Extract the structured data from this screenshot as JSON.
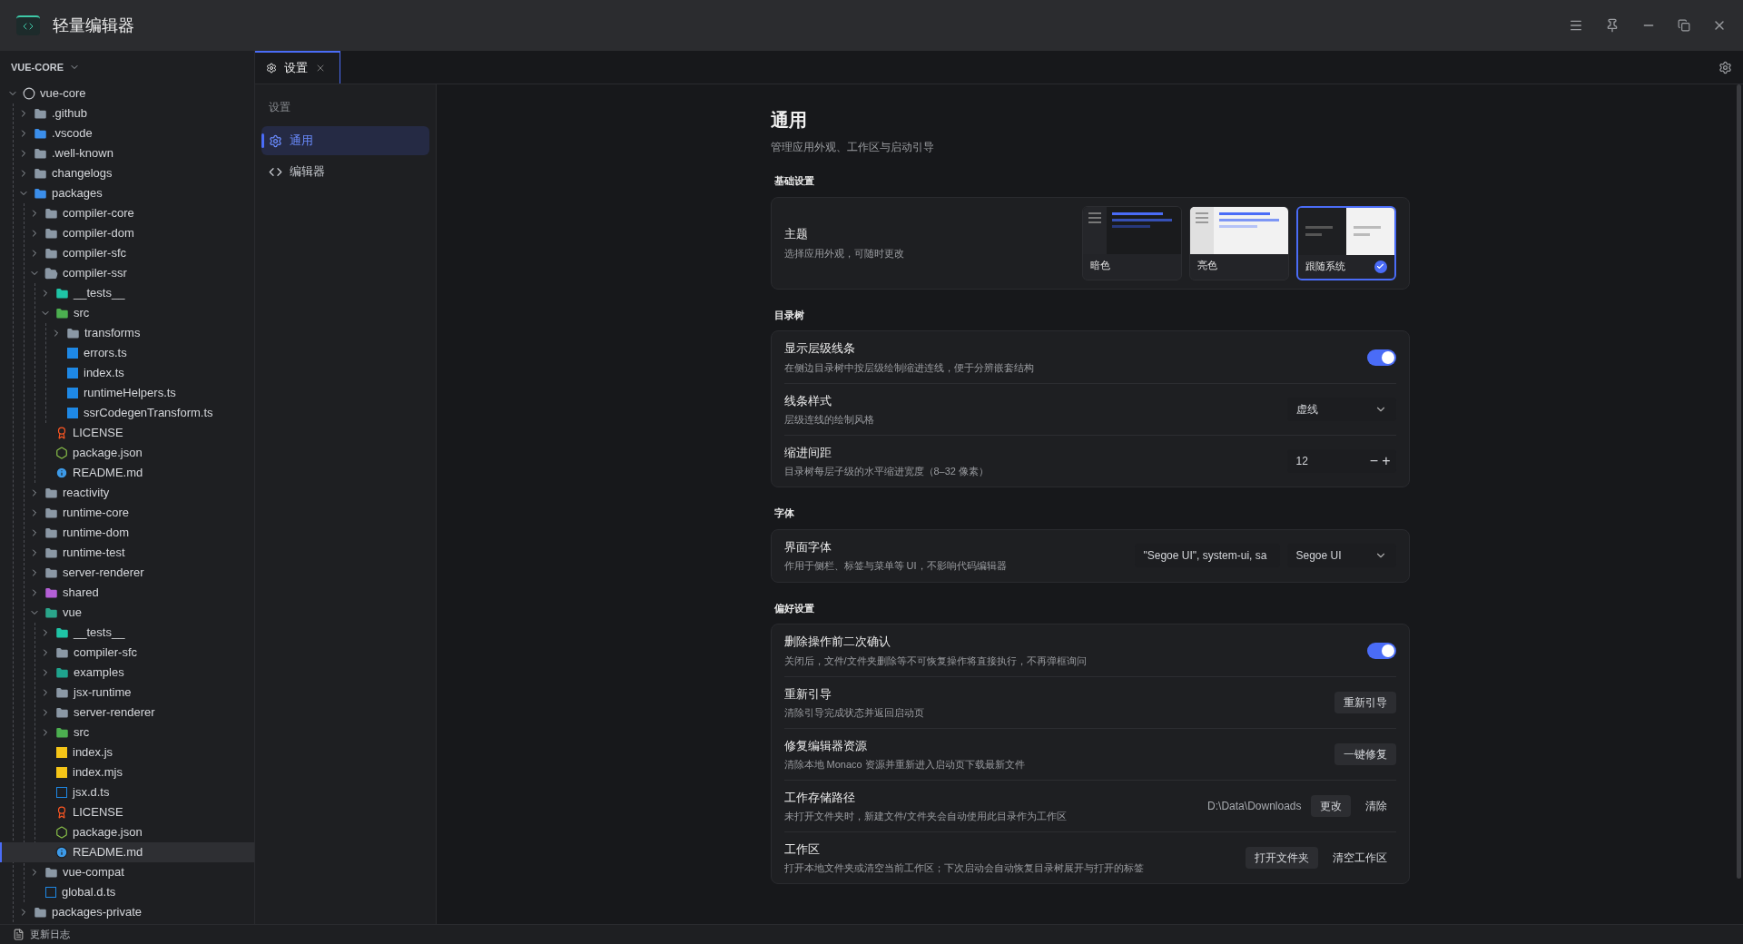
{
  "window": {
    "title": "轻量编辑器"
  },
  "explorer": {
    "title": "VUE-CORE",
    "tree": [
      {
        "name": "vue-core",
        "kind": "root",
        "expanded": true,
        "selected": false,
        "children": [
          {
            "name": ".github",
            "kind": "github",
            "expanded": false,
            "selected": false
          },
          {
            "name": ".vscode",
            "kind": "vscode",
            "expanded": false,
            "selected": false
          },
          {
            "name": ".well-known",
            "kind": "folder",
            "expanded": false,
            "selected": false
          },
          {
            "name": "changelogs",
            "kind": "folder",
            "expanded": false,
            "selected": false
          },
          {
            "name": "packages",
            "kind": "packages",
            "expanded": true,
            "selected": false,
            "children": [
              {
                "name": "compiler-core",
                "kind": "folder",
                "expanded": false,
                "selected": false
              },
              {
                "name": "compiler-dom",
                "kind": "folder",
                "expanded": false,
                "selected": false
              },
              {
                "name": "compiler-sfc",
                "kind": "folder",
                "expanded": false,
                "selected": false
              },
              {
                "name": "compiler-ssr",
                "kind": "open",
                "expanded": true,
                "selected": false,
                "children": [
                  {
                    "name": "__tests__",
                    "kind": "tests",
                    "expanded": false,
                    "selected": false
                  },
                  {
                    "name": "src",
                    "kind": "src",
                    "expanded": true,
                    "selected": false,
                    "children": [
                      {
                        "name": "transforms",
                        "kind": "folder",
                        "expanded": false,
                        "selected": false
                      },
                      {
                        "name": "errors.ts",
                        "kind": "ts",
                        "selected": false
                      },
                      {
                        "name": "index.ts",
                        "kind": "ts",
                        "selected": false
                      },
                      {
                        "name": "runtimeHelpers.ts",
                        "kind": "ts",
                        "selected": false
                      },
                      {
                        "name": "ssrCodegenTransform.ts",
                        "kind": "ts",
                        "selected": false
                      }
                    ]
                  },
                  {
                    "name": "LICENSE",
                    "kind": "license",
                    "selected": false
                  },
                  {
                    "name": "package.json",
                    "kind": "node",
                    "selected": false
                  },
                  {
                    "name": "README.md",
                    "kind": "info",
                    "selected": false
                  }
                ]
              },
              {
                "name": "reactivity",
                "kind": "folder",
                "expanded": false,
                "selected": false
              },
              {
                "name": "runtime-core",
                "kind": "folder",
                "expanded": false,
                "selected": false
              },
              {
                "name": "runtime-dom",
                "kind": "folder",
                "expanded": false,
                "selected": false
              },
              {
                "name": "runtime-test",
                "kind": "folder",
                "expanded": false,
                "selected": false
              },
              {
                "name": "server-renderer",
                "kind": "folder",
                "expanded": false,
                "selected": false
              },
              {
                "name": "shared",
                "kind": "shared",
                "expanded": false,
                "selected": false
              },
              {
                "name": "vue",
                "kind": "vue",
                "expanded": true,
                "selected": false,
                "children": [
                  {
                    "name": "__tests__",
                    "kind": "tests",
                    "expanded": false,
                    "selected": false
                  },
                  {
                    "name": "compiler-sfc",
                    "kind": "folder",
                    "expanded": false,
                    "selected": false
                  },
                  {
                    "name": "examples",
                    "kind": "examples",
                    "expanded": false,
                    "selected": false
                  },
                  {
                    "name": "jsx-runtime",
                    "kind": "folder",
                    "expanded": false,
                    "selected": false
                  },
                  {
                    "name": "server-renderer",
                    "kind": "folder",
                    "expanded": false,
                    "selected": false
                  },
                  {
                    "name": "src",
                    "kind": "src",
                    "expanded": false,
                    "selected": false
                  },
                  {
                    "name": "index.js",
                    "kind": "js",
                    "selected": false
                  },
                  {
                    "name": "index.mjs",
                    "kind": "js",
                    "selected": false
                  },
                  {
                    "name": "jsx.d.ts",
                    "kind": "dts",
                    "selected": false
                  },
                  {
                    "name": "LICENSE",
                    "kind": "license",
                    "selected": false
                  },
                  {
                    "name": "package.json",
                    "kind": "node",
                    "selected": false
                  },
                  {
                    "name": "README.md",
                    "kind": "info",
                    "selected": true
                  }
                ]
              },
              {
                "name": "vue-compat",
                "kind": "folder",
                "expanded": false,
                "selected": false
              },
              {
                "name": "global.d.ts",
                "kind": "dts",
                "selected": false
              }
            ]
          },
          {
            "name": "packages-private",
            "kind": "folder",
            "expanded": false,
            "selected": false
          }
        ]
      }
    ]
  },
  "tabs": [
    {
      "label": "设置",
      "selected": true
    }
  ],
  "settings_nav": {
    "title": "设置",
    "items": [
      {
        "label": "通用",
        "kind": "gear",
        "selected": true
      },
      {
        "label": "编辑器",
        "kind": "code",
        "selected": false
      }
    ]
  },
  "page": {
    "title": "通用",
    "subtitle": "管理应用外观、工作区与启动引导"
  },
  "sections": [
    {
      "title": "基础设置",
      "rows": [
        {
          "kind": "theme",
          "label": "主题",
          "description": "选择应用外观，可随时更改",
          "options": [
            {
              "label": "暗色",
              "kind": "dark",
              "selected": false
            },
            {
              "label": "亮色",
              "kind": "light",
              "selected": false
            },
            {
              "label": "跟随系统",
              "kind": "system",
              "selected": true
            }
          ]
        }
      ]
    },
    {
      "title": "目录树",
      "rows": [
        {
          "kind": "toggle",
          "label": "显示层级线条",
          "description": "在侧边目录树中按层级绘制缩进连线，便于分辨嵌套结构",
          "on": true
        },
        {
          "kind": "select",
          "label": "线条样式",
          "description": "层级连线的绘制风格",
          "value": "虚线"
        },
        {
          "kind": "stepper",
          "label": "缩进间距",
          "description": "目录树每层子级的水平缩进宽度（8–32 像素）",
          "value": "12",
          "minus": "−",
          "plus": "+"
        }
      ]
    },
    {
      "title": "字体",
      "rows": [
        {
          "kind": "font",
          "label": "界面字体",
          "description": "作用于侧栏、标签与菜单等 UI，不影响代码编辑器",
          "input": "\"Segoe UI\", system-ui, sa",
          "value": "Segoe UI"
        }
      ]
    },
    {
      "title": "偏好设置",
      "rows": [
        {
          "kind": "toggle",
          "label": "删除操作前二次确认",
          "description": "关闭后，文件/文件夹删除等不可恢复操作将直接执行，不再弹框询问",
          "on": true
        },
        {
          "kind": "buttons",
          "label": "重新引导",
          "description": "清除引导完成状态并返回启动页",
          "buttons": [
            {
              "label": "重新引导",
              "kind": "filled"
            }
          ]
        },
        {
          "kind": "buttons",
          "label": "修复编辑器资源",
          "description": "清除本地 Monaco 资源并重新进入启动页下载最新文件",
          "buttons": [
            {
              "label": "一键修复",
              "kind": "filled"
            }
          ]
        },
        {
          "kind": "buttons",
          "label": "工作存储路径",
          "description": "未打开文件夹时，新建文件/文件夹会自动使用此目录作为工作区",
          "path": "D:\\Data\\Downloads",
          "buttons": [
            {
              "label": "更改",
              "kind": "filled"
            },
            {
              "label": "清除",
              "kind": "plain"
            }
          ]
        },
        {
          "kind": "buttons",
          "label": "工作区",
          "description": "打开本地文件夹或清空当前工作区；下次启动会自动恢复目录树展开与打开的标签",
          "buttons": [
            {
              "label": "打开文件夹",
              "kind": "filled"
            },
            {
              "label": "清空工作区",
              "kind": "plain"
            }
          ]
        }
      ]
    }
  ],
  "status_bar": {
    "label": "更新日志"
  }
}
